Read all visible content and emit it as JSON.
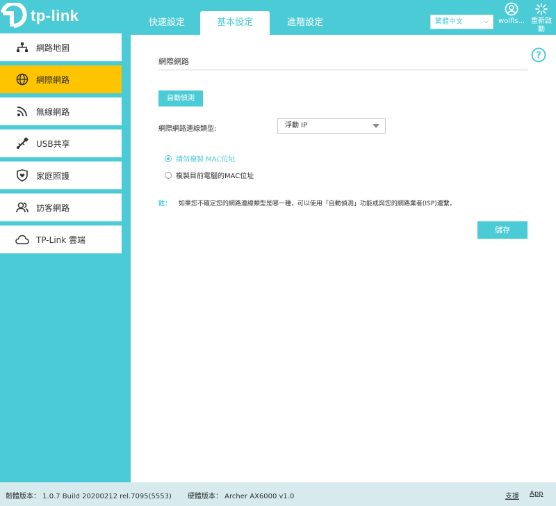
{
  "brand": {
    "logo_text": "tp-link"
  },
  "nav": {
    "tabs": [
      {
        "label": "快速設定"
      },
      {
        "label": "基本設定"
      },
      {
        "label": "進階設定"
      }
    ]
  },
  "header": {
    "language": "繁體中文",
    "user_label": "wolfls...",
    "reboot_label_line1": "重新啟",
    "reboot_label_line2": "動"
  },
  "sidebar": {
    "items": [
      {
        "label": "網路地圖",
        "icon": "network-map-icon"
      },
      {
        "label": "網際網路",
        "icon": "globe-icon",
        "active": true
      },
      {
        "label": "無線網路",
        "icon": "wifi-icon"
      },
      {
        "label": "USB共享",
        "icon": "usb-icon"
      },
      {
        "label": "家庭照護",
        "icon": "shield-heart-icon"
      },
      {
        "label": "訪客網路",
        "icon": "guest-icon"
      },
      {
        "label": "TP-Link 雲端",
        "icon": "cloud-icon"
      }
    ]
  },
  "main": {
    "section_title": "網際網路",
    "auto_detect_label": "自動偵測",
    "connection_type_label": "網際網路連線類型:",
    "connection_type_value": "浮動 IP",
    "mac_options": [
      {
        "label": "請勿複製 MAC位址",
        "checked": true
      },
      {
        "label": "複製目前電腦的MAC位址",
        "checked": false
      }
    ],
    "note_label": "註：",
    "note_text": "如果您不確定您的網路連線類型是哪一種，可以使用「自動偵測」功能或與您的網路業者(ISP)連繫。",
    "save_label": "儲存"
  },
  "footer": {
    "firmware": "韌體版本： 1.0.7 Build 20200212 rel.7095(5553)",
    "hardware": "硬體版本： Archer AX6000 v1.0",
    "support_link": "支援",
    "app_link": "App"
  },
  "colors": {
    "accent": "#4acbd6",
    "active_item": "#ffc400"
  }
}
